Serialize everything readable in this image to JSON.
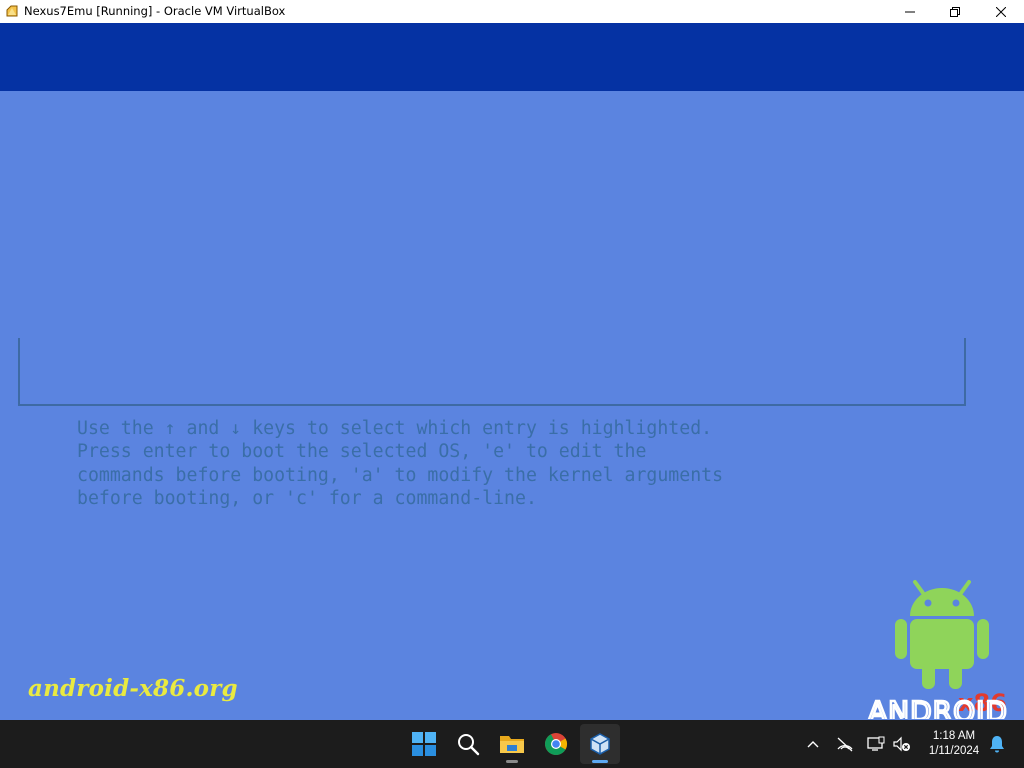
{
  "window": {
    "title": "Nexus7Emu [Running] - Oracle VM VirtualBox",
    "controls": [
      "minimize-icon",
      "maximize-icon",
      "close-icon"
    ]
  },
  "vm": {
    "help_lines": [
      "Use the ↑ and ↓ keys to select which entry is highlighted.",
      "Press enter to boot the selected OS, 'e' to edit the",
      "commands before booting, 'a' to modify the kernel arguments",
      "before booting, or 'c' for a command-line."
    ],
    "site": "android-x86.org",
    "logo": {
      "badge": "x86",
      "wordmark": "ANDROID"
    }
  },
  "taskbar": {
    "apps": [
      "windows-start-icon",
      "search-icon",
      "file-explorer-icon",
      "chrome-icon",
      "virtualbox-icon"
    ],
    "tray_icons": [
      "chevron-up-icon",
      "network-icon",
      "display-icon",
      "volume-muted-icon",
      "notification-bell-icon"
    ],
    "time": "1:18 AM",
    "date": "1/11/2024"
  },
  "colors": {
    "vm_background": "#5b84e0",
    "vm_top_band": "#0532a3",
    "grub_text": "#3a6ea8",
    "site_text": "#e9ea41",
    "android_green": "#8fd45a",
    "taskbar": "#1c1c1c"
  }
}
